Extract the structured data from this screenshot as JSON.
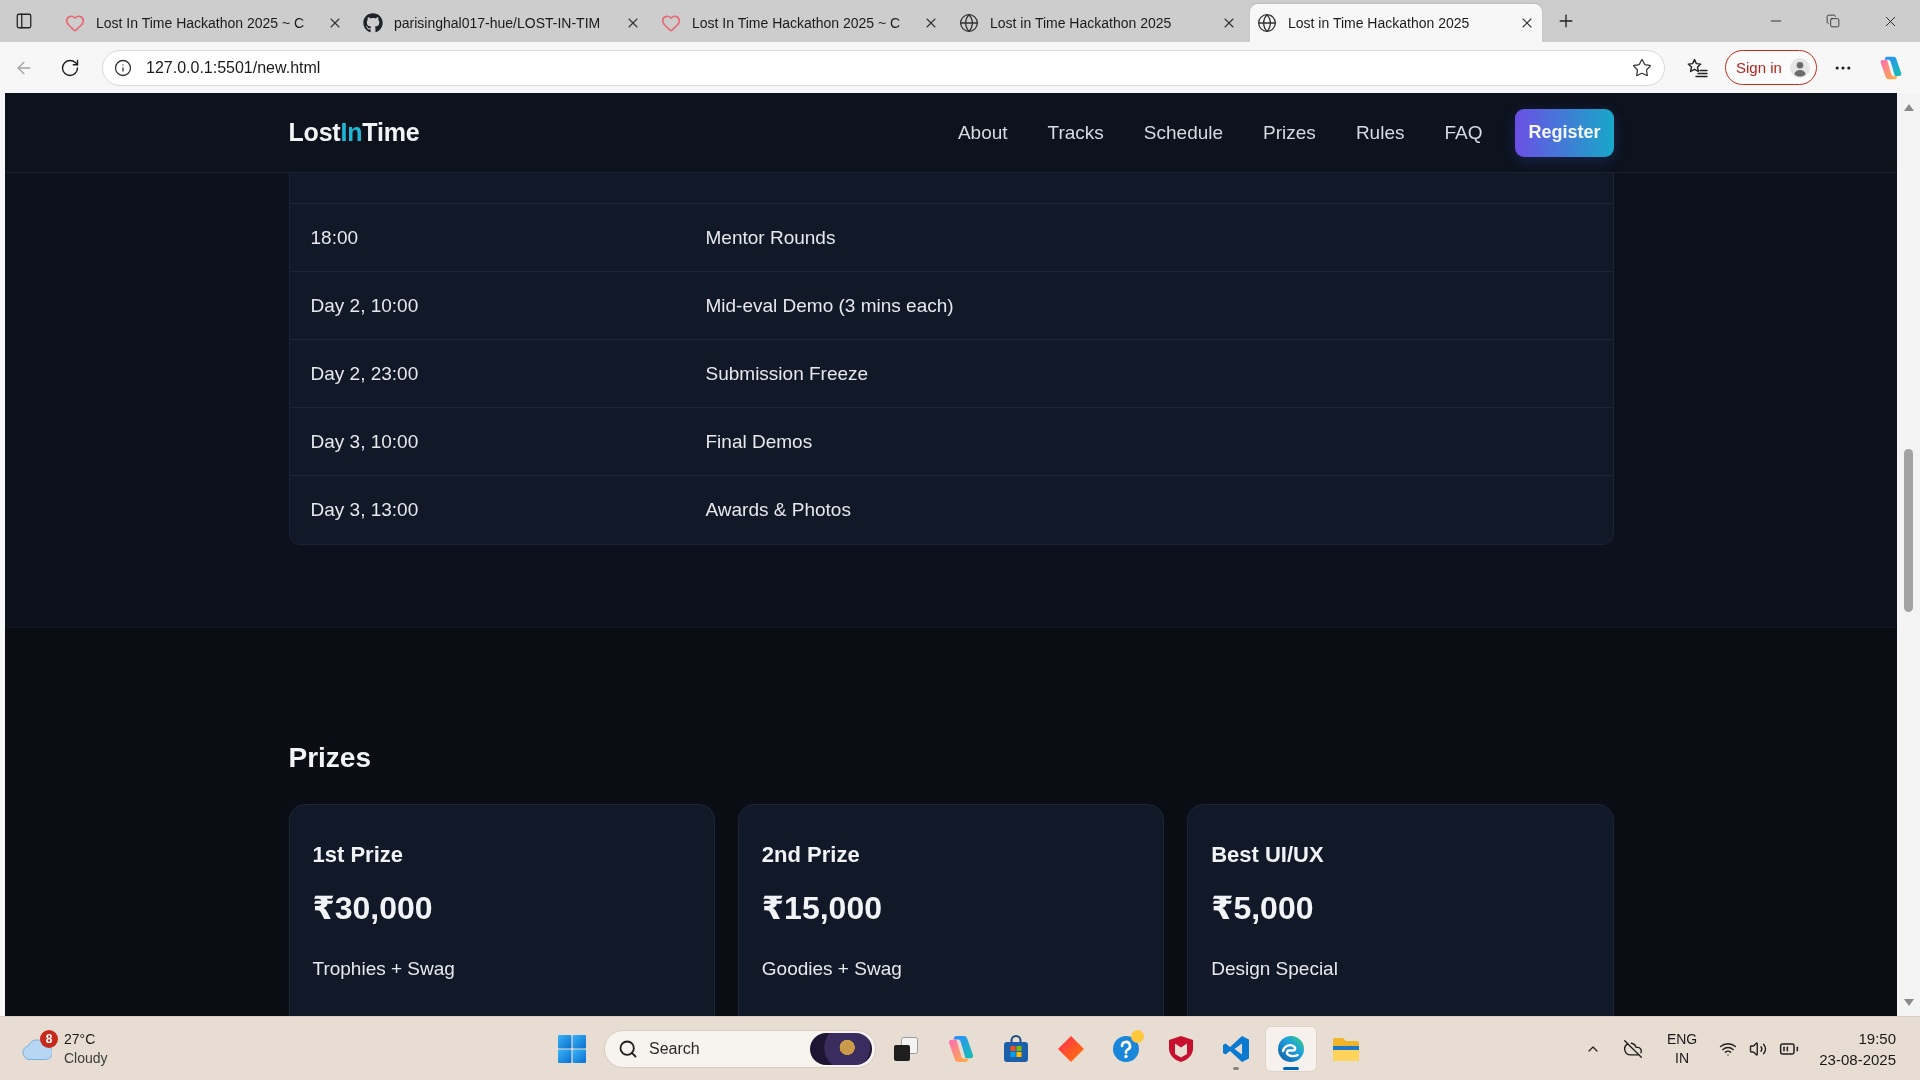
{
  "browser": {
    "tabs": [
      {
        "title": "Lost In Time Hackathon 2025 ~ C",
        "kind": "heart",
        "selected": false
      },
      {
        "title": "parisinghal017-hue/LOST-IN-TIM",
        "kind": "cat",
        "selected": false
      },
      {
        "title": "Lost In Time Hackathon 2025 ~ C",
        "kind": "heart",
        "selected": false
      },
      {
        "title": "Lost in Time Hackathon 2025",
        "kind": "globe",
        "selected": false
      },
      {
        "title": "Lost in Time Hackathon 2025",
        "kind": "globe",
        "selected": true
      }
    ],
    "back_disabled": true,
    "address": "127.0.0.1:5501/new.html",
    "sign_in": "Sign in"
  },
  "navbar": {
    "logo": [
      {
        "text": "Lost",
        "accent": false
      },
      {
        "text": "In",
        "accent": true
      },
      {
        "text": "Time",
        "accent": false
      }
    ],
    "links": [
      "About",
      "Tracks",
      "Schedule",
      "Prizes",
      "Rules",
      "FAQ"
    ],
    "register": "Register"
  },
  "schedule": {
    "rows": [
      {
        "time": "18:00",
        "event": "Mentor Rounds"
      },
      {
        "time": "Day 2, 10:00",
        "event": "Mid-eval Demo (3 mins each)"
      },
      {
        "time": "Day 2, 23:00",
        "event": "Submission Freeze"
      },
      {
        "time": "Day 3, 10:00",
        "event": "Final Demos"
      },
      {
        "time": "Day 3, 13:00",
        "event": "Awards & Photos"
      }
    ]
  },
  "prizes": {
    "title": "Prizes",
    "cards": [
      {
        "title": "1st Prize",
        "amount": "₹30,000",
        "note": "Trophies + Swag"
      },
      {
        "title": "2nd Prize",
        "amount": "₹15,000",
        "note": "Goodies + Swag"
      },
      {
        "title": "Best UI/UX",
        "amount": "₹5,000",
        "note": "Design Special"
      }
    ]
  },
  "taskbar": {
    "weather": {
      "alerts": "8",
      "temperature": "27°C",
      "condition": "Cloudy"
    },
    "search": {
      "placeholder": "Search"
    },
    "apps": [
      {
        "kind": "task-view",
        "selected": false,
        "running": false,
        "alert": false
      },
      {
        "kind": "swirl",
        "selected": false,
        "running": false,
        "alert": false
      },
      {
        "kind": "store",
        "selected": false,
        "running": false,
        "alert": false
      },
      {
        "kind": "diamond",
        "selected": false,
        "running": false,
        "alert": false
      },
      {
        "kind": "help",
        "selected": false,
        "running": false,
        "alert": true
      },
      {
        "kind": "shield",
        "selected": false,
        "running": false,
        "alert": false
      },
      {
        "kind": "ribbon",
        "selected": false,
        "running": true,
        "alert": false
      },
      {
        "kind": "wave",
        "selected": true,
        "running": true,
        "alert": false
      },
      {
        "kind": "folder",
        "selected": false,
        "running": false,
        "alert": false
      }
    ],
    "language": {
      "input": "ENG",
      "region": "IN"
    },
    "clock": {
      "time": "19:50",
      "date": "23-08-2025"
    }
  }
}
